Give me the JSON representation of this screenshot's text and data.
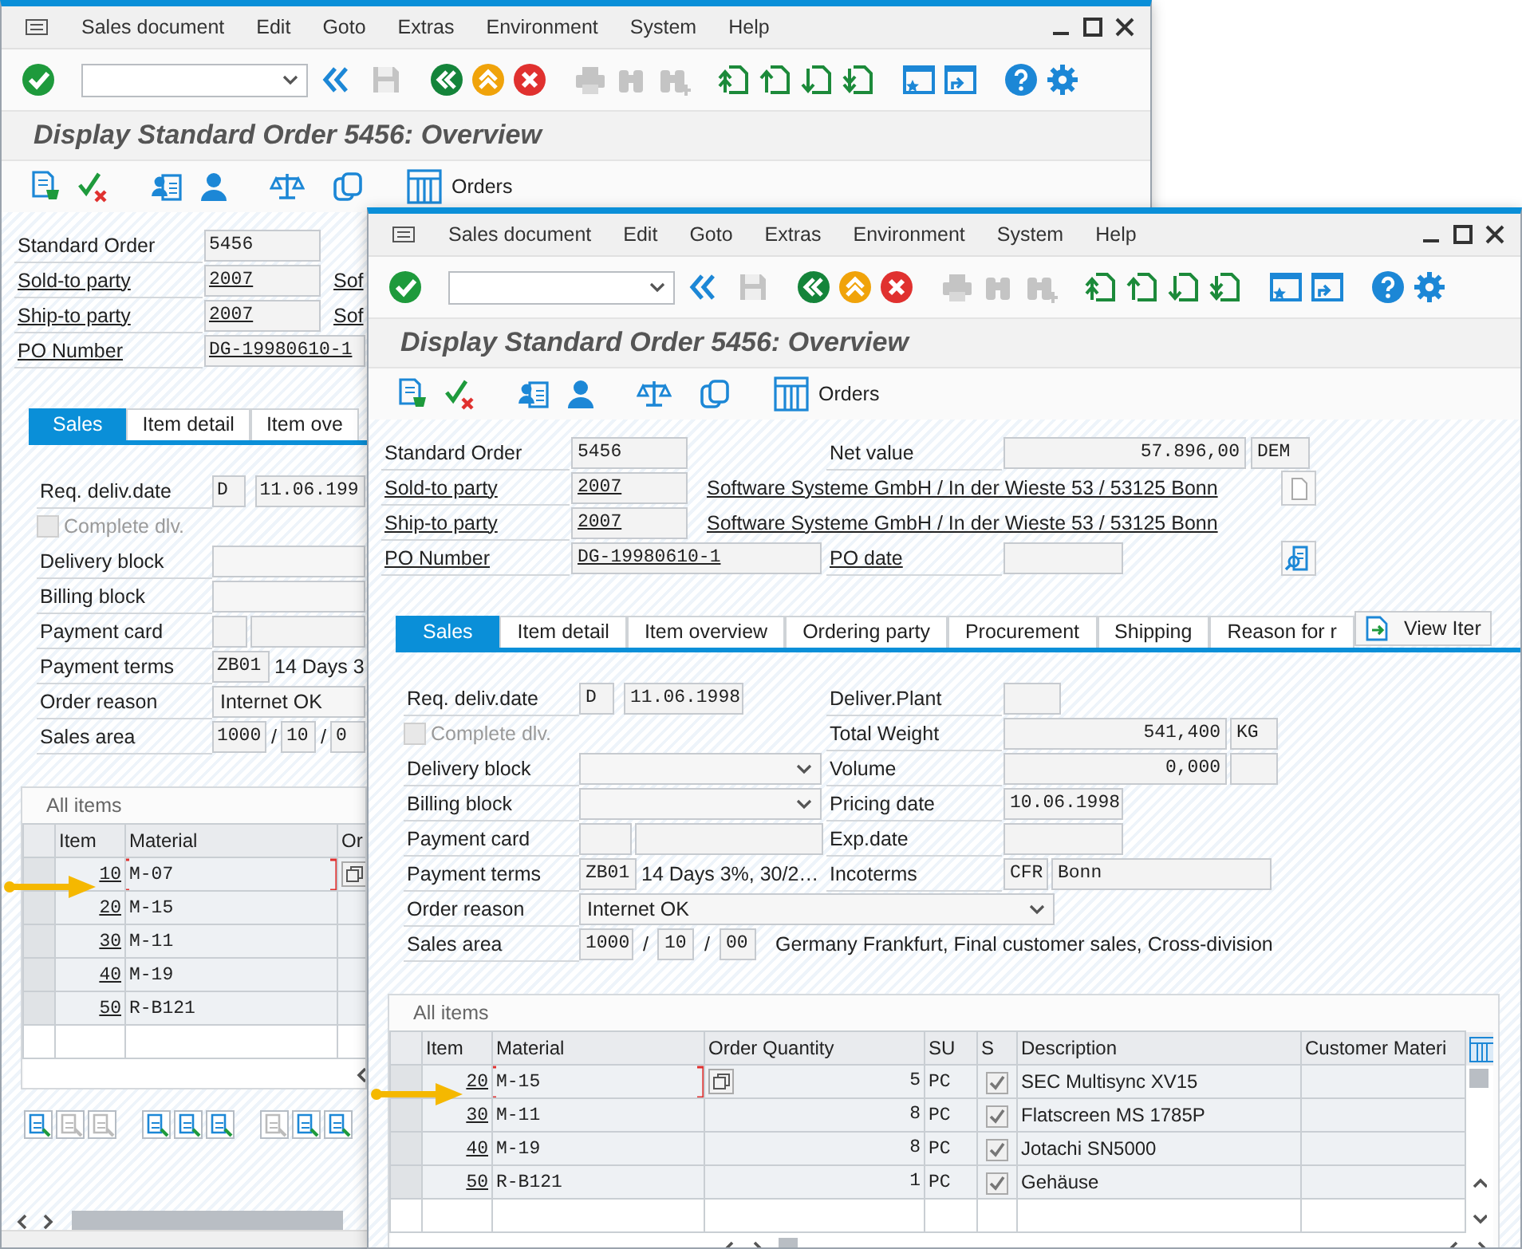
{
  "back_window": {
    "menu": [
      "Sales document",
      "Edit",
      "Goto",
      "Extras",
      "Environment",
      "System",
      "Help"
    ],
    "title": "Display Standard Order 5456: Overview",
    "orders_button": "Orders",
    "header": {
      "standard_order": {
        "label": "Standard Order",
        "value": "5456",
        "link": false
      },
      "sold_to": {
        "label": "Sold-to party",
        "value": "2007",
        "address": "Sof",
        "link": true
      },
      "ship_to": {
        "label": "Ship-to party",
        "value": "2007",
        "address": "Sof",
        "link": true
      },
      "po_number": {
        "label": "PO Number",
        "value": "DG-19980610-1",
        "link": true
      }
    },
    "tabs": [
      {
        "label": "Sales",
        "selected": true
      },
      {
        "label": "Item detail",
        "selected": false
      },
      {
        "label": "Item ove",
        "selected": false
      }
    ],
    "sales": {
      "req_deliv_date": {
        "label": "Req. deliv.date",
        "type": "D",
        "date": "11.06.199"
      },
      "complete_dlv": {
        "label": "Complete dlv.",
        "checked": false,
        "disabled": true
      },
      "delivery_block": {
        "label": "Delivery block"
      },
      "billing_block": {
        "label": "Billing block"
      },
      "payment_card": {
        "label": "Payment card"
      },
      "payment_terms": {
        "label": "Payment terms",
        "code": "ZB01",
        "text": "14 Days 3"
      },
      "order_reason": {
        "label": "Order reason",
        "value": "Internet OK"
      },
      "sales_area": {
        "label": "Sales area",
        "org": "1000",
        "separator": "/",
        "channel": "10",
        "separator_2": "/",
        "division": "0"
      }
    },
    "items": {
      "title": "All items",
      "columns": [
        "Item",
        "Material",
        "Or"
      ],
      "rows": [
        {
          "item": "10",
          "material": "M-07",
          "selected": true
        },
        {
          "item": "20",
          "material": "M-15",
          "selected": false
        },
        {
          "item": "30",
          "material": "M-11",
          "selected": false
        },
        {
          "item": "40",
          "material": "M-19",
          "selected": false
        },
        {
          "item": "50",
          "material": "R-B121",
          "selected": false
        }
      ]
    }
  },
  "front_window": {
    "menu": [
      "Sales document",
      "Edit",
      "Goto",
      "Extras",
      "Environment",
      "System",
      "Help"
    ],
    "title": "Display Standard Order 5456: Overview",
    "orders_button": "Orders",
    "header": {
      "standard_order": {
        "label": "Standard Order",
        "value": "5456",
        "link": false
      },
      "net_value": {
        "label": "Net value",
        "value": "57.896,00",
        "currency": "DEM",
        "link": false
      },
      "sold_to": {
        "label": "Sold-to party",
        "value": "2007",
        "address": "Software Systeme GmbH / In der Wieste 53 / 53125 Bonn",
        "link": true,
        "icon_button": true
      },
      "ship_to": {
        "label": "Ship-to party",
        "value": "2007",
        "address": "Software Systeme GmbH / In der Wieste 53 / 53125 Bonn",
        "link": true
      },
      "po_number": {
        "label": "PO Number",
        "value": "DG-19980610-1",
        "link": true
      },
      "po_date": {
        "label": "PO date",
        "link": true,
        "icon_button": true
      }
    },
    "tabs": [
      {
        "label": "Sales",
        "selected": true
      },
      {
        "label": "Item detail",
        "selected": false
      },
      {
        "label": "Item overview",
        "selected": false
      },
      {
        "label": "Ordering party",
        "selected": false
      },
      {
        "label": "Procurement",
        "selected": false
      },
      {
        "label": "Shipping",
        "selected": false
      },
      {
        "label": "Reason for r",
        "selected": false
      }
    ],
    "view_button": "View Iter",
    "sales": {
      "req_deliv_date": {
        "label": "Req. deliv.date",
        "type": "D",
        "date": "11.06.1998"
      },
      "deliver_plant": {
        "label": "Deliver.Plant"
      },
      "complete_dlv": {
        "label": "Complete dlv.",
        "checked": false,
        "disabled": true
      },
      "total_weight": {
        "label": "Total Weight",
        "value": "541,400",
        "unit": "KG"
      },
      "delivery_block": {
        "label": "Delivery block",
        "dropdown": true
      },
      "volume": {
        "label": "Volume",
        "value": "0,000"
      },
      "billing_block": {
        "label": "Billing block",
        "dropdown": true
      },
      "pricing_date": {
        "label": "Pricing date",
        "value": "10.06.1998"
      },
      "payment_card": {
        "label": "Payment card"
      },
      "exp_date": {
        "label": "Exp.date"
      },
      "payment_terms": {
        "label": "Payment terms",
        "code": "ZB01",
        "text": "14 Days 3%, 30/2…"
      },
      "incoterms": {
        "label": "Incoterms",
        "code": "CFR",
        "place": "Bonn"
      },
      "order_reason": {
        "label": "Order reason",
        "value": "Internet OK",
        "dropdown": true
      },
      "sales_area": {
        "label": "Sales area",
        "org": "1000",
        "separator": "/",
        "channel": "10",
        "separator_2": "/",
        "division": "00",
        "text": "Germany Frankfurt, Final customer sales, Cross-division"
      }
    },
    "items": {
      "title": "All items",
      "columns": [
        "Item",
        "Material",
        "Order Quantity",
        "SU",
        "S",
        "Description",
        "Customer Materi"
      ],
      "rows": [
        {
          "item": "20",
          "material": "M-15",
          "quantity": "5",
          "unit": "PC",
          "checked": true,
          "description": "SEC Multisync XV15",
          "selected": true
        },
        {
          "item": "30",
          "material": "M-11",
          "quantity": "8",
          "unit": "PC",
          "checked": true,
          "description": "Flatscreen MS 1785P",
          "selected": false
        },
        {
          "item": "40",
          "material": "M-19",
          "quantity": "8",
          "unit": "PC",
          "checked": true,
          "description": "Jotachi SN5000",
          "selected": false
        },
        {
          "item": "50",
          "material": "R-B121",
          "quantity": "1",
          "unit": "PC",
          "checked": true,
          "description": "Gehäuse",
          "selected": false
        }
      ]
    }
  }
}
